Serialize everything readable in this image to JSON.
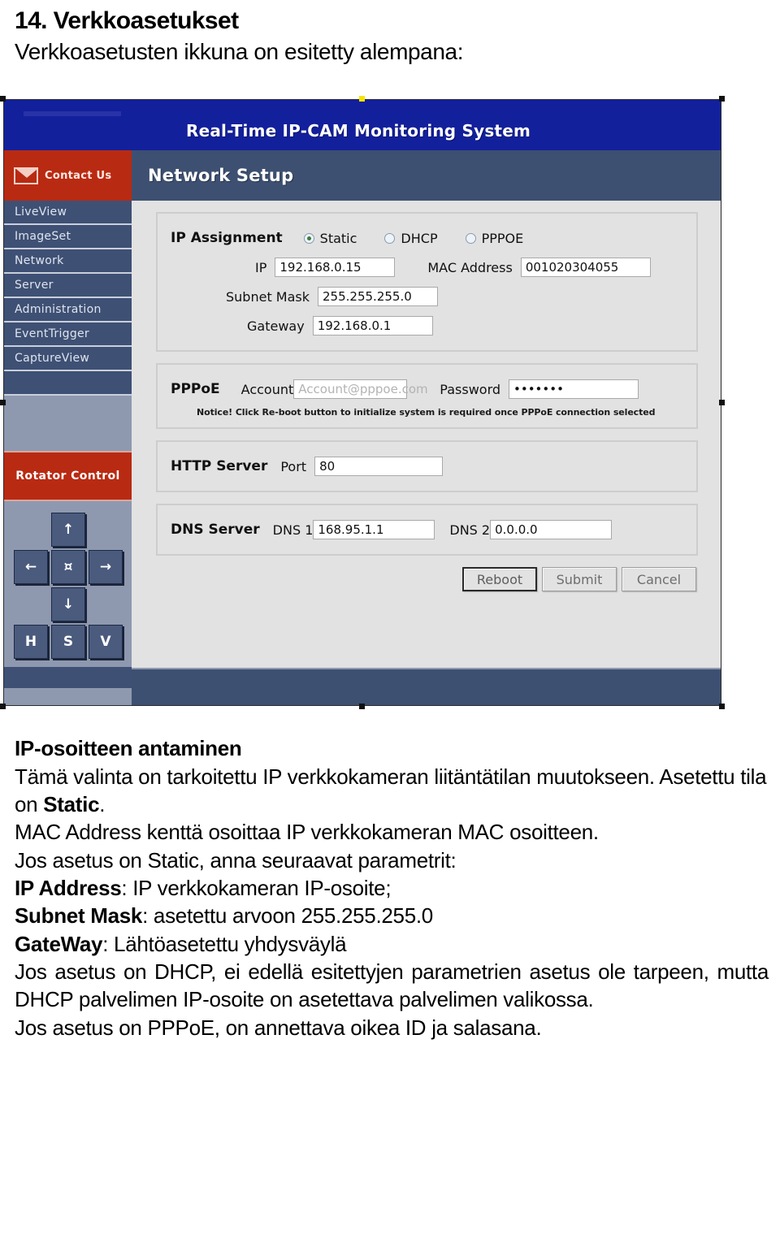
{
  "document": {
    "heading": "14. Verkkoasetukset",
    "subheading": "Verkkoasetusten ikkuna on esitetty alempana:"
  },
  "screenshot": {
    "banner_title": "Real-Time IP-CAM Monitoring System",
    "contact": {
      "label": "Contact Us",
      "icon": "envelope-icon"
    },
    "nav_items": [
      {
        "label": "LiveView"
      },
      {
        "label": "ImageSet"
      },
      {
        "label": "Network"
      },
      {
        "label": "Server"
      },
      {
        "label": "Administration"
      },
      {
        "label": "EventTrigger"
      },
      {
        "label": "CaptureView"
      },
      {
        "label": ""
      }
    ],
    "rotator": {
      "title": "Rotator Control",
      "buttons": [
        {
          "glyph": "↑",
          "name": "tilt-up-button"
        },
        {
          "glyph": "←",
          "name": "pan-left-button"
        },
        {
          "glyph": "¤",
          "name": "home-position-button"
        },
        {
          "glyph": "→",
          "name": "pan-right-button"
        },
        {
          "glyph": "↓",
          "name": "tilt-down-button"
        },
        {
          "glyph": "H",
          "name": "horizontal-scan-button"
        },
        {
          "glyph": "S",
          "name": "scan-button"
        },
        {
          "glyph": "V",
          "name": "vertical-scan-button"
        }
      ]
    },
    "page_title": "Network Setup",
    "ip_assignment": {
      "label": "IP Assignment",
      "options": [
        {
          "label": "Static",
          "selected": true
        },
        {
          "label": "DHCP",
          "selected": false
        },
        {
          "label": "PPPOE",
          "selected": false
        }
      ],
      "ip_label": "IP",
      "ip_value": "192.168.0.15",
      "mac_label": "MAC Address",
      "mac_value": "001020304055",
      "subnet_label": "Subnet Mask",
      "subnet_value": "255.255.255.0",
      "gateway_label": "Gateway",
      "gateway_value": "192.168.0.1"
    },
    "pppoe": {
      "label": "PPPoE",
      "account_label": "Account",
      "account_placeholder": "Account@pppoe.com",
      "password_label": "Password",
      "password_value": "•••••••",
      "notice": "Notice! Click Re-boot button to initialize system is required once PPPoE connection selected"
    },
    "http_server": {
      "label": "HTTP Server",
      "port_label": "Port",
      "port_value": "80"
    },
    "dns_server": {
      "label": "DNS Server",
      "dns1_label": "DNS 1",
      "dns1_value": "168.95.1.1",
      "dns2_label": "DNS 2",
      "dns2_value": "0.0.0.0"
    },
    "buttons": {
      "reboot": "Reboot",
      "submit": "Submit",
      "cancel": "Cancel"
    },
    "colors": {
      "banner_blue": "#13209c",
      "title_slate": "#3d5071",
      "accent_red": "#b92a12",
      "nav_blue": "#3e5074",
      "panel_gray": "#e2e2e2"
    }
  },
  "body": {
    "section_title": "IP-osoitteen antaminen",
    "para1_a": "Tämä valinta on tarkoitettu IP verkkokameran liitäntätilan muutokseen. Asetettu tila on ",
    "para1_bold": "Static",
    "para1_b": ".",
    "para2": "MAC Address kenttä osoittaa IP verkkokameran MAC osoitteen.",
    "para3": "Jos asetus on Static, anna seuraavat parametrit:",
    "line_ip_label": "IP Address",
    "line_ip_rest": ": IP verkkokameran IP-osoite;",
    "line_subnet_label": "Subnet Mask",
    "line_subnet_rest": ": asetettu arvoon 255.255.255.0",
    "line_gw_label": "GateWay",
    "line_gw_rest": ": Lähtöasetettu yhdysväylä",
    "para4": "Jos asetus on DHCP, ei edellä esitettyjen parametrien asetus ole tarpeen, mutta DHCP palvelimen IP-osoite on asetettava palvelimen valikossa.",
    "para5": "Jos asetus on PPPoE, on annettava oikea ID ja salasana."
  }
}
